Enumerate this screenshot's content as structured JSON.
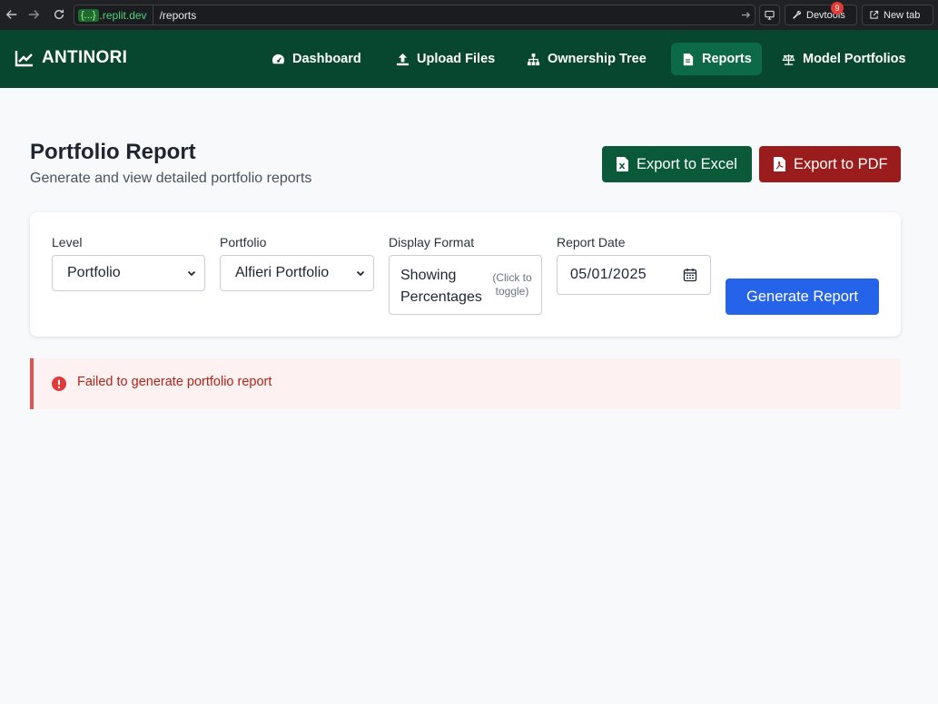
{
  "browser": {
    "url_host_chip": "{...}",
    "url_host": ".replit.dev",
    "url_path": "/reports",
    "devtools_label": "Devtools",
    "devtools_badge": "9",
    "new_tab_label": "New tab"
  },
  "header": {
    "brand": "ANTINORI",
    "nav": [
      {
        "label": "Dashboard",
        "icon": "gauge-icon"
      },
      {
        "label": "Upload Files",
        "icon": "upload-icon"
      },
      {
        "label": "Ownership Tree",
        "icon": "sitemap-icon"
      },
      {
        "label": "Reports",
        "icon": "file-icon",
        "active": true
      },
      {
        "label": "Model Portfolios",
        "icon": "scale-icon"
      }
    ]
  },
  "page": {
    "title": "Portfolio Report",
    "subtitle": "Generate and view detailed portfolio reports",
    "export_excel": "Export to Excel",
    "export_pdf": "Export to PDF"
  },
  "form": {
    "level_label": "Level",
    "level_value": "Portfolio",
    "portfolio_label": "Portfolio",
    "portfolio_value": "Alfieri Portfolio",
    "format_label": "Display Format",
    "format_value": "Showing Percentages",
    "format_hint": "(Click to toggle)",
    "date_label": "Report Date",
    "date_value": "05/01/2025",
    "generate_label": "Generate Report"
  },
  "alert": {
    "message": "Failed to generate portfolio report"
  },
  "colors": {
    "header_bg": "#07472f",
    "nav_active": "#0d6a48",
    "excel": "#0a5a3a",
    "pdf": "#9b1c1c",
    "primary": "#2563eb",
    "error": "#e05252"
  }
}
